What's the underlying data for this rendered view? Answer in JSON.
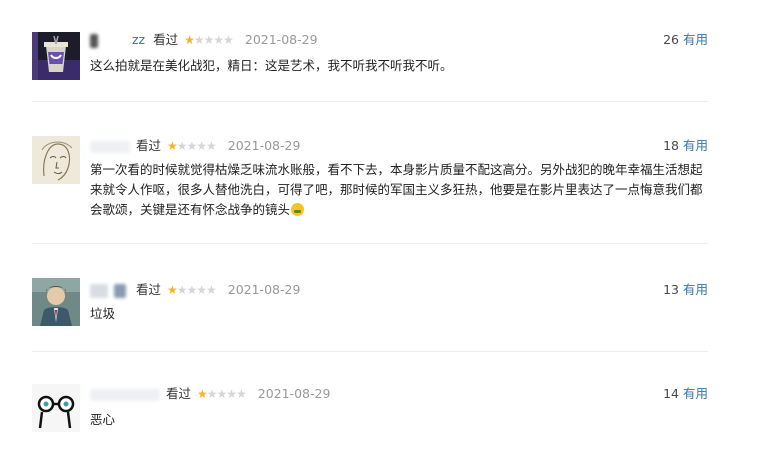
{
  "vote_label": "有用",
  "stars_on": "★",
  "stars_off": "★",
  "reviews": [
    {
      "username": "zz",
      "verb": "看过",
      "rating_stars": 1,
      "rating_max": 5,
      "date": "2021-08-29",
      "votes": "26",
      "content": "这么拍就是在美化战犯，精日：这是艺术，我不听我不听我不听。",
      "avatar_icon": "avatar-cup-icon"
    },
    {
      "username": "",
      "verb": "看过",
      "rating_stars": 1,
      "rating_max": 5,
      "date": "2021-08-29",
      "votes": "18",
      "content": "第一次看的时候就觉得枯燥乏味流水账般，看不下去，本身影片质量不配这高分。另外战犯的晚年幸福生活想起来就令人作呕，很多人替他洗白，可得了吧，那时候的军国主义多狂热，他要是在影片里表达了一点悔意我们都会歌颂，关键是还有怀念战争的镜头",
      "avatar_icon": "avatar-sketch-icon"
    },
    {
      "username": "",
      "verb": "看过",
      "rating_stars": 1,
      "rating_max": 5,
      "date": "2021-08-29",
      "votes": "13",
      "content": "垃圾",
      "avatar_icon": "avatar-anime-icon"
    },
    {
      "username": "",
      "verb": "看过",
      "rating_stars": 1,
      "rating_max": 5,
      "date": "2021-08-29",
      "votes": "14",
      "content": "恶心",
      "avatar_icon": "avatar-glasses-icon"
    }
  ],
  "colors": {
    "link": "#3377aa",
    "star_on": "#f5b325",
    "star_off": "#d6d6d6",
    "date": "#999999",
    "divider": "#ececec"
  }
}
